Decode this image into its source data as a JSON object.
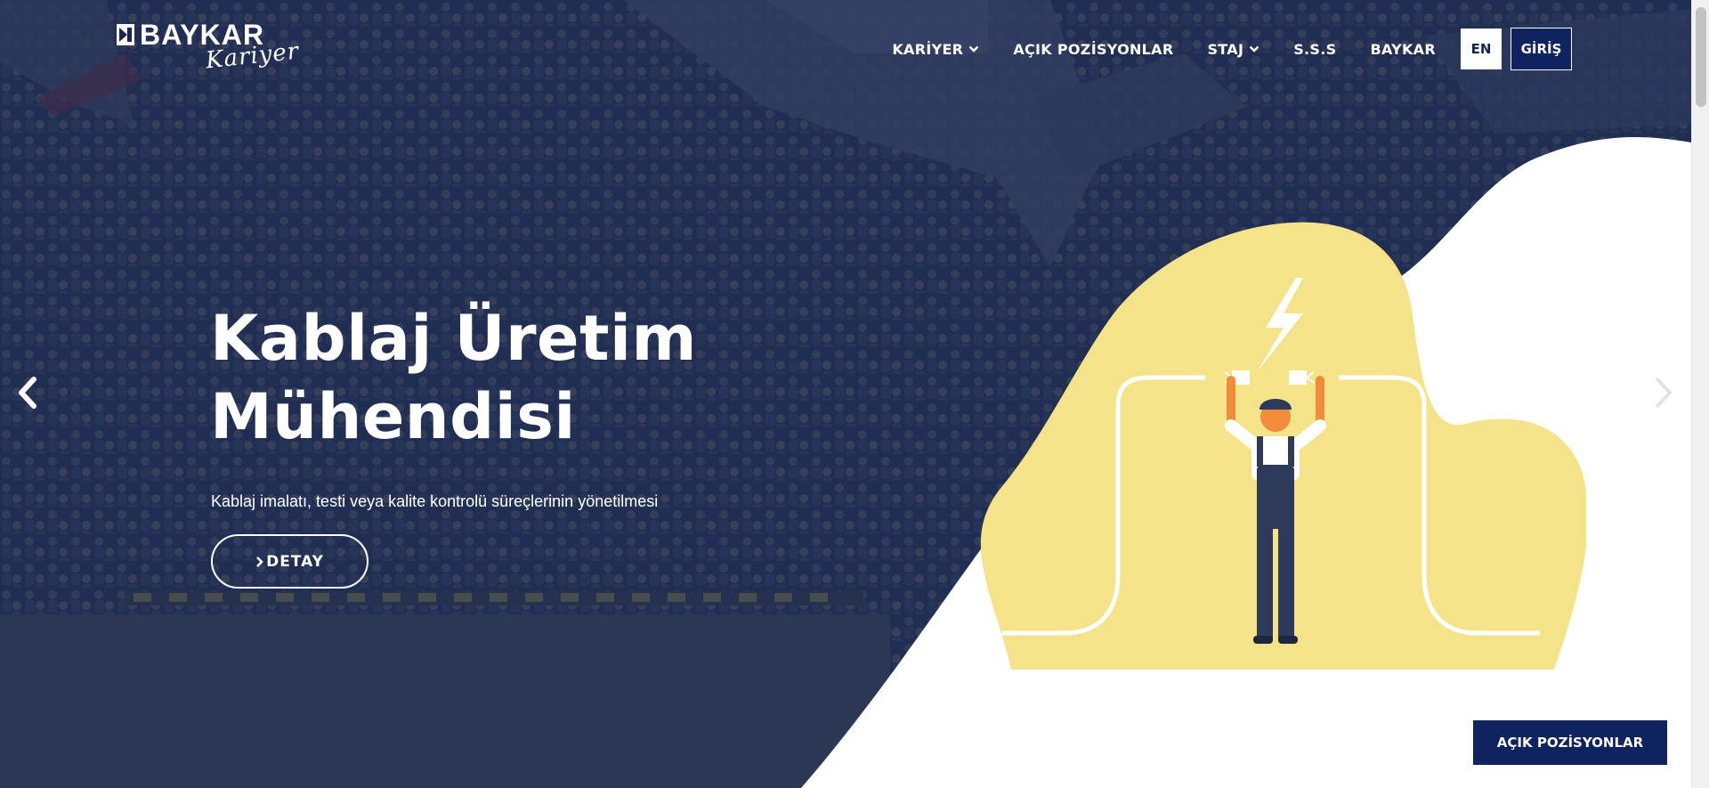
{
  "brand": {
    "name": "BAYKAR",
    "script": "Kariyer"
  },
  "nav": {
    "items": [
      {
        "label": "KARİYER",
        "icon": "chevron-down-icon"
      },
      {
        "label": "AÇIK POZİSYONLAR"
      },
      {
        "label": "STAJ",
        "icon": "chevron-down-icon"
      },
      {
        "label": "S.S.S"
      },
      {
        "label": "BAYKAR"
      }
    ],
    "language": "EN",
    "login": "GİRİŞ"
  },
  "hero": {
    "title_line1": "Kablaj Üretim",
    "title_line2": "Mühendisi",
    "subtitle": "Kablaj imalatı, testi veya kalite kontrolü süreçlerinin yönetilmesi",
    "detail_button": "DETAY",
    "detail_icon": "chevron-right-icon"
  },
  "carousel": {
    "prev_icon": "chevron-left-icon",
    "next_icon": "chevron-right-icon"
  },
  "floating_button": "AÇIK POZİSYONLAR",
  "colors": {
    "navy": "#0f2360",
    "overlay": "#1c2a4f",
    "blob_yellow": "#f5e38a",
    "white": "#ffffff"
  }
}
